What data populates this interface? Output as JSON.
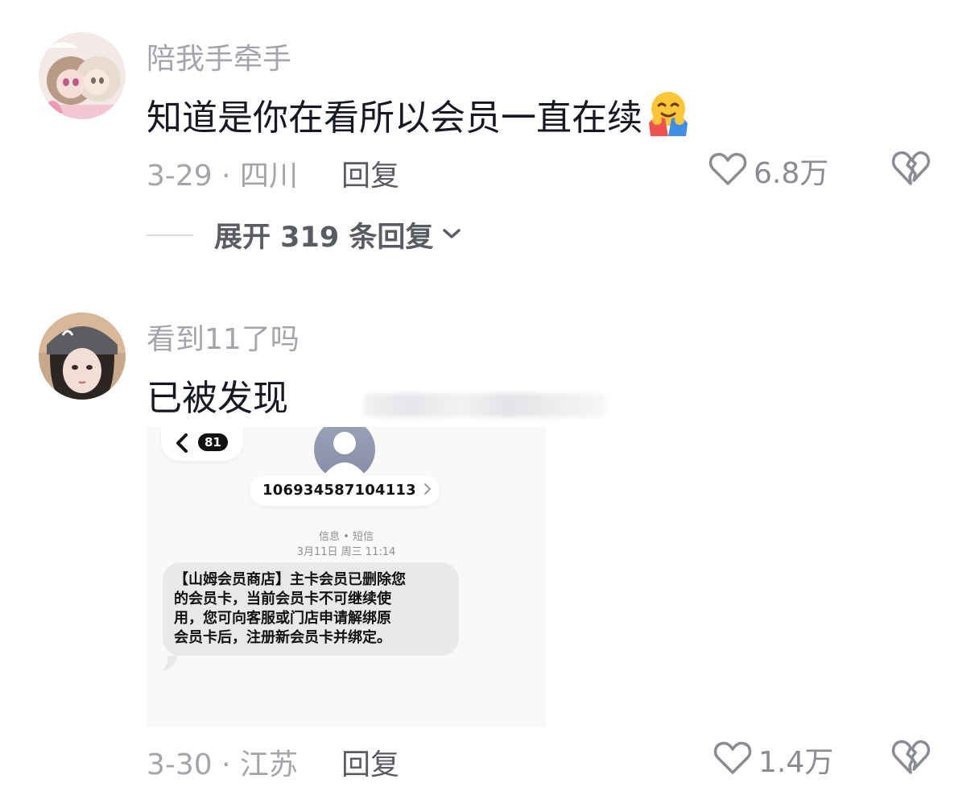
{
  "comments": [
    {
      "username": "陪我手牵手",
      "text": "知道是你在看所以会员一直在续",
      "emoji": "🤗",
      "date_location": "3-29 · 四川",
      "reply_label": "回复",
      "like_count": "6.8万",
      "expand_label": "展开 319 条回复"
    },
    {
      "username": "看到11了吗",
      "text": "已被发现",
      "date_location": "3-30 · 江苏",
      "reply_label": "回复",
      "like_count": "1.4万",
      "screenshot": {
        "badge": "81",
        "number": "106934587104113",
        "label_type": "信息 • 短信",
        "label_date": "3月11日 周三 11:14",
        "bubble_lines": [
          "【山姆会员商店】主卡会员已删除您",
          "的会员卡，当前会员卡不可继续使",
          "用，您可向客服或门店申请解绑原",
          "会员卡后，注册新会员卡并绑定。"
        ]
      }
    }
  ],
  "icons": {
    "like": "heart-outline-icon",
    "dislike": "broken-heart-icon",
    "expand": "chevron-down-icon",
    "back": "chevron-left-icon",
    "contact": "person-icon"
  },
  "colors": {
    "secondary_text": "#a3a5ab",
    "primary_text": "#161823",
    "reply_text": "#5a5c63",
    "sms_bubble": "#e9e9eb"
  }
}
